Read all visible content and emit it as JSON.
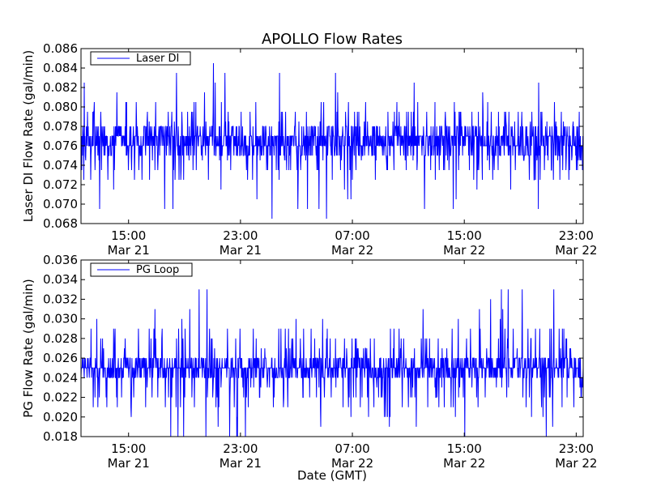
{
  "title": "APOLLO Flow Rates",
  "chart_data": [
    {
      "type": "line",
      "ylabel": "Laser DI Flow Rate (gal/min)",
      "xlabel": "",
      "ylim": [
        0.068,
        0.086
      ],
      "yticks": [
        "0.068",
        "0.070",
        "0.072",
        "0.074",
        "0.076",
        "0.078",
        "0.080",
        "0.082",
        "0.084",
        "0.086"
      ],
      "xticks": [
        {
          "time": "15:00",
          "date": "Mar 21"
        },
        {
          "time": "23:00",
          "date": "Mar 21"
        },
        {
          "time": "07:00",
          "date": "Mar 22"
        },
        {
          "time": "15:00",
          "date": "Mar 22"
        },
        {
          "time": "23:00",
          "date": "Mar 22"
        }
      ],
      "xlim_hours": [
        11.6,
        23.6
      ],
      "xtick_hours": [
        15,
        23,
        31,
        39,
        47
      ],
      "xlim_days_offset": [
        11.6,
        47.5
      ],
      "series": [
        {
          "name": "Laser DI",
          "color": "#0000ff",
          "baseline": 0.0765,
          "band": [
            0.075,
            0.078
          ],
          "min": 0.068,
          "max": 0.086
        }
      ],
      "legend": "top-left",
      "grid": false
    },
    {
      "type": "line",
      "ylabel": "PG Flow Rate (gal/min)",
      "xlabel": "Date (GMT)",
      "ylim": [
        0.018,
        0.036
      ],
      "yticks": [
        "0.018",
        "0.020",
        "0.022",
        "0.024",
        "0.026",
        "0.028",
        "0.030",
        "0.032",
        "0.034",
        "0.036"
      ],
      "xticks": [
        {
          "time": "15:00",
          "date": "Mar 21"
        },
        {
          "time": "23:00",
          "date": "Mar 21"
        },
        {
          "time": "07:00",
          "date": "Mar 22"
        },
        {
          "time": "15:00",
          "date": "Mar 22"
        },
        {
          "time": "23:00",
          "date": "Mar 22"
        }
      ],
      "xlim_days_offset": [
        11.6,
        47.5
      ],
      "xtick_hours": [
        15,
        23,
        31,
        39,
        47
      ],
      "series": [
        {
          "name": "PG Loop",
          "color": "#0000ff",
          "baseline": 0.025,
          "band": [
            0.024,
            0.026
          ],
          "min": 0.018,
          "max": 0.035
        }
      ],
      "legend": "top-left",
      "grid": false
    }
  ]
}
